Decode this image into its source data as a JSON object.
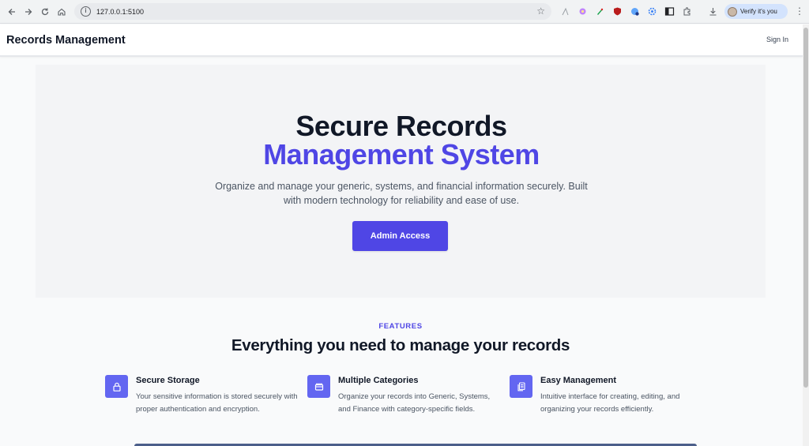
{
  "browser": {
    "url": "127.0.0.1:5100",
    "profile_label": "Verify it's you"
  },
  "header": {
    "brand": "Records Management",
    "signin": "Sign In"
  },
  "hero": {
    "title_line1": "Secure Records",
    "title_line2": "Management System",
    "description": "Organize and manage your generic, systems, and financial information securely. Built with modern technology for reliability and ease of use.",
    "cta_label": "Admin Access"
  },
  "features": {
    "eyebrow": "FEATURES",
    "heading": "Everything you need to manage your records",
    "items": [
      {
        "icon": "lock-icon",
        "title": "Secure Storage",
        "description": "Your sensitive information is stored securely with proper authentication and encryption."
      },
      {
        "icon": "folder-icon",
        "title": "Multiple Categories",
        "description": "Organize your records into Generic, Systems, and Finance with category-specific fields."
      },
      {
        "icon": "documents-icon",
        "title": "Easy Management",
        "description": "Intuitive interface for creating, editing, and organizing your records efficiently."
      }
    ]
  },
  "colors": {
    "accent": "#4f46e5",
    "icon_bg": "#6366f1",
    "hero_bg": "#f3f4f6"
  }
}
